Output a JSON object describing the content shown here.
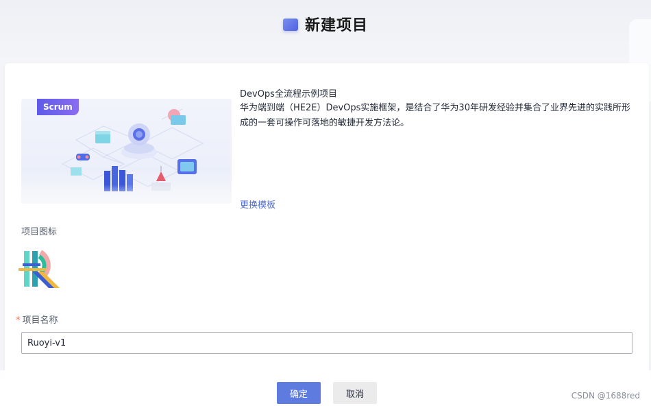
{
  "header": {
    "title": "新建项目",
    "icon": "project-folder-icon"
  },
  "template": {
    "badge": "Scrum",
    "title": "DevOps全流程示例项目",
    "description": "华为端到端（HE2E）DevOps实施框架，是结合了华为30年研发经验并集合了业界先进的实践所形成的一套可操作可落地的敏捷开发方法论。",
    "change_link": "更换模板"
  },
  "form": {
    "icon_label": "项目图标",
    "name_required_mark": "*",
    "name_label": "项目名称",
    "name_value": "Ruoyi-v1"
  },
  "footer": {
    "ok_label": "确定",
    "cancel_label": "取消",
    "watermark": "CSDN @1688red"
  },
  "colors": {
    "primary": "#5e7ce0",
    "link": "#526ecc",
    "required": "#f66f6a"
  }
}
